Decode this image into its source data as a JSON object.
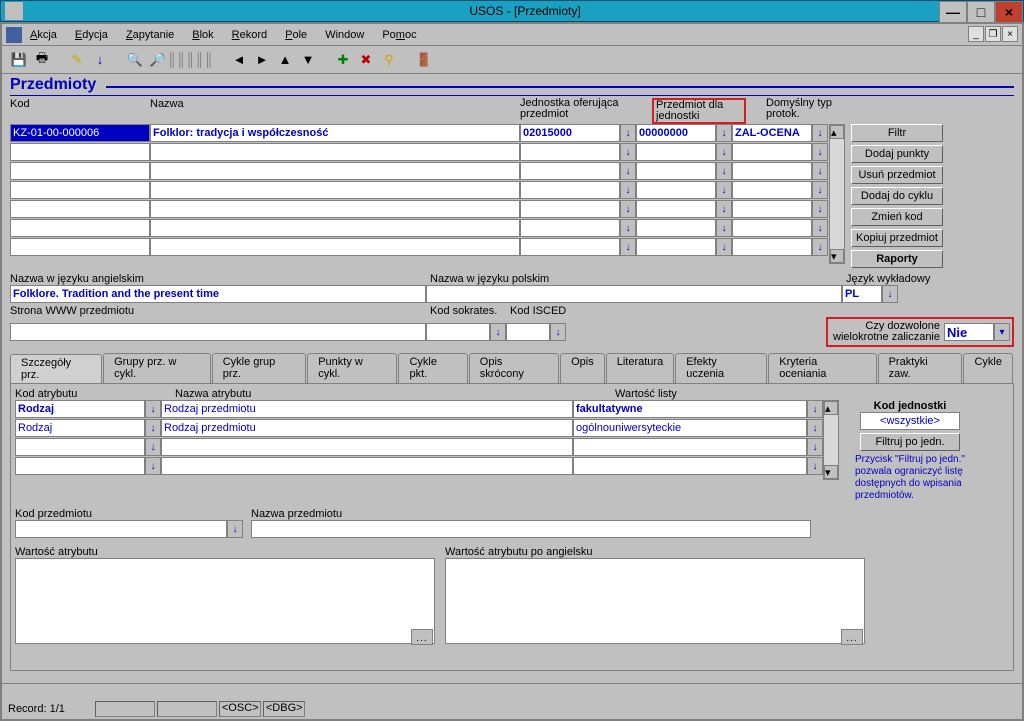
{
  "window": {
    "title": "USOS - [Przedmioty]"
  },
  "menu": {
    "items": [
      "Akcja",
      "Edycja",
      "Zapytanie",
      "Blok",
      "Rekord",
      "Pole",
      "Window",
      "Pomoc"
    ]
  },
  "form": {
    "title": "Przedmioty"
  },
  "columns": {
    "kod": "Kod",
    "nazwa": "Nazwa",
    "jednostka_oferujaca": "Jednostka oferująca przedmiot",
    "przedmiot_dla_jednostki": "Przedmiot dla jednostki",
    "domyslny_typ_protok": "Domyślny typ protok."
  },
  "grid": {
    "rows": [
      {
        "kod": "KZ-01-00-000006",
        "nazwa": "Folklor: tradycja i współczesność",
        "jedn_of": "02015000",
        "jedn_dla": "00000000",
        "typ_protok": "ZAL-OCENA"
      }
    ]
  },
  "side_buttons": {
    "filtr": "Filtr",
    "dodaj_punkty": "Dodaj punkty",
    "usun_przedmiot": "Usuń przedmiot",
    "dodaj_do_cyklu": "Dodaj do cyklu",
    "zmien_kod": "Zmień kod",
    "kopiuj_przedmiot": "Kopiuj przedmiot",
    "raporty": "Raporty"
  },
  "lang_section": {
    "nazwa_ang_label": "Nazwa w języku angielskim",
    "nazwa_pl_label": "Nazwa w języku polskim",
    "jezyk_wykladowy_label": "Język wykładowy",
    "nazwa_ang_value": "Folklore. Tradition and the present time",
    "jezyk_value": "PL"
  },
  "url_section": {
    "strona_www_label": "Strona WWW  przedmiotu",
    "kod_sokrates_label": "Kod sokrates.",
    "kod_isced_label": "Kod ISCED",
    "czy_dozwolone_label": "Czy dozwolone wielokrotne zaliczanie",
    "czy_dozwolone_value": "Nie"
  },
  "tabs": {
    "items": [
      "Szczegóły prz.",
      "Grupy prz. w cykl.",
      "Cykle grup prz.",
      "Punkty w cykl.",
      "Cykle pkt.",
      "Opis skrócony",
      "Opis",
      "Literatura",
      "Efekty uczenia",
      "Kryteria oceniania",
      "Praktyki zaw.",
      "Cykle"
    ]
  },
  "tab_content": {
    "kod_atrybutu_label": "Kod atrybutu",
    "nazwa_atrybutu_label": "Nazwa atrybutu",
    "wartosc_listy_label": "Wartość listy",
    "kod_jednostki_label": "Kod jednostki",
    "rows": [
      {
        "kod": "Rodzaj",
        "nazwa": "Rodzaj przedmiotu",
        "wartosc": "fakultatywne"
      },
      {
        "kod": "Rodzaj",
        "nazwa": "Rodzaj przedmiotu",
        "wartosc": "ogólnouniwersyteckie"
      }
    ],
    "wszystkie": "<wszystkie>",
    "filtruj_po_jedn": "Filtruj po jedn.",
    "hint": "Przycisk \"Filtruj po jedn.\" pozwala ograniczyć listę dostępnych do wpisania przedmiotów.",
    "kod_przedmiotu_label": "Kod przedmiotu",
    "nazwa_przedmiotu_label": "Nazwa przedmiotu",
    "wartosc_atrybutu_label": "Wartość atrybutu",
    "wartosc_atrybutu_ang_label": "Wartość atrybutu po angielsku"
  },
  "status": {
    "record": "Record: 1/1",
    "osc": "<OSC>",
    "dbg": "<DBG>"
  }
}
